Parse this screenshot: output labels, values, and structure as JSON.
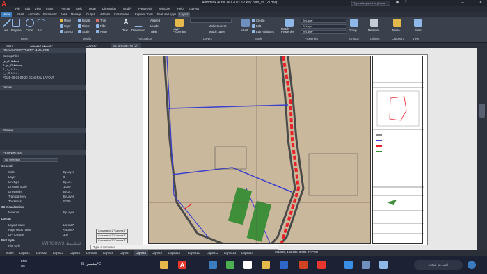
{
  "app": {
    "title": "Autodesk AutoCAD 2021    02.key plan_sn (2).dwg",
    "app_button": "A",
    "search_placeholder": "Type a keyword or phrase"
  },
  "menubar": [
    "File",
    "Edit",
    "View",
    "Insert",
    "Format",
    "Tools",
    "Draw",
    "Dimension",
    "Modify",
    "Parametric",
    "Window",
    "Help",
    "Express"
  ],
  "ribbon_tabs": [
    "Home",
    "Insert",
    "Annotate",
    "Parametric",
    "View",
    "Manage",
    "Output",
    "Add-ins",
    "Collaborate",
    "Express Tools",
    "Featured Apps",
    "Layout"
  ],
  "ribbon": {
    "draw": {
      "line": "Line",
      "polyline": "Polyline",
      "circle": "Circle",
      "arc": "Arc",
      "label": "Draw"
    },
    "modify": {
      "move": "Move",
      "rotate": "Rotate",
      "trim": "Trim",
      "copy": "Copy",
      "mirror": "Mirror",
      "fillet": "Fillet",
      "stretch": "Stretch",
      "scale": "Scale",
      "array": "Array",
      "label": "Modify"
    },
    "annotation": {
      "text": "Text",
      "dimension": "Dimension",
      "aligned": "Aligned",
      "leader": "Leader",
      "table": "Table",
      "label": "Annotation"
    },
    "layers": {
      "layer_properties": "Layer Properties",
      "make_current": "Make Current",
      "match_layer": "Match Layer",
      "label": "Layers"
    },
    "block": {
      "insert": "Insert",
      "create": "Create",
      "edit": "Edit",
      "edit_attributes": "Edit Attributes",
      "label": "Block"
    },
    "properties": {
      "match": "Match Properties",
      "bylayer1": "ByLayer",
      "bylayer2": "ByLayer",
      "bylayer3": "ByLayer",
      "label": "Properties"
    },
    "groups": {
      "group": "Group",
      "label": "Groups"
    },
    "utilities": {
      "measure": "Measure",
      "label": "Utilities"
    },
    "clipboard": {
      "paste": "Paste",
      "label": "Clipboard"
    },
    "view": {
      "base": "Base",
      "label": "View"
    }
  },
  "doc_tabs": [
    "Start",
    "الخريطة الكهربائية*",
    "COVER*",
    "02.key plan_sn (2)*"
  ],
  "drawing_recovery": {
    "title": "DRAWING RECOVERY MANAGER",
    "backup_files": "Backup Files",
    "files": [
      "مخطط الأرض",
      "مخطط الأرض 2",
      "مخطط رقم 1",
      "مخطط الإنارة",
      "P11-E-09-01-03-20 GENERAL LAYOUT"
    ],
    "details": "Details",
    "preview": "Preview"
  },
  "properties": {
    "title": "PROPERTIES",
    "selection": "No selection",
    "general": "General",
    "rows": [
      {
        "k": "Color",
        "v": "ByLayer"
      },
      {
        "k": "Layer",
        "v": "0"
      },
      {
        "k": "Linetype",
        "v": "ByLa..."
      },
      {
        "k": "Linetype scale",
        "v": "1.000"
      },
      {
        "k": "Lineweight",
        "v": "ByLa..."
      },
      {
        "k": "Transparency",
        "v": "ByLayer"
      },
      {
        "k": "Thickness",
        "v": "0.000"
      }
    ],
    "viz": "3D Visualization",
    "material": {
      "k": "Material",
      "v": "ByLayer"
    },
    "layout": "Layout",
    "layout_rows": [
      {
        "k": "Layout name",
        "v": "Layout7"
      },
      {
        "k": "Page setup name",
        "v": "<None>"
      },
      {
        "k": "DPI to raster",
        "v": "300"
      }
    ],
    "plot_style": "Plot style",
    "plot_row": {
      "k": "Plot style",
      "v": ""
    }
  },
  "callouts": [
    "Conversion 1 \"Camera1\"",
    "Conversion 2 \"Camera2\"",
    "Conversion 3 \"Camera3\""
  ],
  "command_placeholder": "Type a command",
  "layout_tabs": [
    "Model",
    "Layout1",
    "Layout2",
    "Layout3",
    "Layout4",
    "Layout5",
    "Layout6",
    "Layout7",
    "Layout8",
    "Layout9",
    "Layout10",
    "Layout11",
    "Layout12",
    "Layout13",
    "Layout14"
  ],
  "active_layout": "Layout8",
  "status": {
    "coords": "631.507, 163.885, 0.000",
    "paper": "PAPER"
  },
  "taskbar": {
    "weather": "مشمس 35°C",
    "lang": "ENG",
    "region": "US",
    "time": "اكتب هنا للبحث"
  },
  "windows_watermark": "Windows تنشيط",
  "colors": {
    "accent": "#3b7bbf",
    "red_road": "#e8232b",
    "blue_lines": "#3a3fd1",
    "green_field": "#3f8f3a",
    "autocad_red": "#e8372f"
  }
}
